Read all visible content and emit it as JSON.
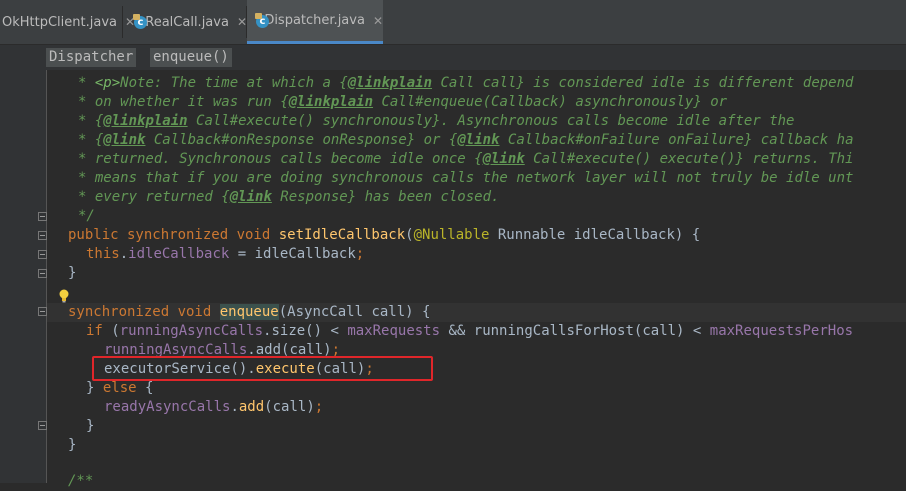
{
  "tabs": [
    {
      "label": "OkHttpClient.java",
      "active": false
    },
    {
      "label": "RealCall.java",
      "active": false
    },
    {
      "label": "Dispatcher.java",
      "active": true
    }
  ],
  "breadcrumb": [
    "Dispatcher",
    "enqueue()"
  ],
  "code": {
    "l1": {
      "a": "* ",
      "b": "<p>",
      "c": "Note: The time at which a {",
      "d": "@linkplain",
      "e": " Call ",
      "f": "call} is considered idle is different depend"
    },
    "l2": {
      "a": "* on whether it was run {",
      "b": "@linkplain",
      "c": " Call#",
      "d": "enqueue",
      "e": "(Callback)",
      "f": " asynchronously} or"
    },
    "l3": {
      "a": "* {",
      "b": "@linkplain",
      "c": " Call#",
      "d": "execute",
      "e": "() synchronously}. Asynchronous calls become idle after the"
    },
    "l4": {
      "a": "* {",
      "b": "@link",
      "c": " Callback#",
      "d": "onResponse",
      "e": " onResponse} or {",
      "f": "@link",
      "g": " Callback#",
      "h": "onFailure",
      "i": " onFailure} callback ha"
    },
    "l5": {
      "a": "* returned. Synchronous calls become idle once {",
      "b": "@link",
      "c": " Call#",
      "d": "execute",
      "e": "() execute()} returns. Thi"
    },
    "l6": {
      "a": "* means that if you are doing synchronous calls the network layer will not truly be idle unt"
    },
    "l7": {
      "a": "* every returned {",
      "b": "@link",
      "c": " Response",
      "d": "} has been closed."
    },
    "l8": {
      "a": "*/"
    },
    "l9": {
      "a": "public synchronized void ",
      "b": "setIdleCallback",
      "c": "(",
      "d": "@Nullable",
      "e": " Runnable idleCallback) {"
    },
    "l10": {
      "a": "this",
      "b": ".",
      "c": "idleCallback",
      "d": " = idleCallback",
      "e": ";"
    },
    "l11": {
      "a": "}"
    },
    "l12": {
      "a": "synchronized void ",
      "b": "enqueue",
      "c": "(AsyncCall call) {"
    },
    "l13": {
      "a": "if ",
      "b": "(",
      "c": "runningAsyncCalls",
      "d": ".size() < ",
      "e": "maxRequests",
      "f": " && runningCallsForHost(call) < ",
      "g": "maxRequestsPerHos"
    },
    "l14": {
      "a": "runningAsyncCalls",
      "b": ".add(call)",
      "c": ";"
    },
    "l15": {
      "a": "executorService().",
      "b": "execute",
      "c": "(call)",
      "d": ";"
    },
    "l16": {
      "a": "} ",
      "b": "else",
      "c": " {"
    },
    "l17": {
      "a": "readyAsyncCalls",
      "b": ".",
      "c": "add",
      "d": "(call)",
      "e": ";"
    },
    "l18": {
      "a": "}"
    },
    "l19": {
      "a": "}"
    },
    "l20": {
      "a": "/**"
    }
  }
}
